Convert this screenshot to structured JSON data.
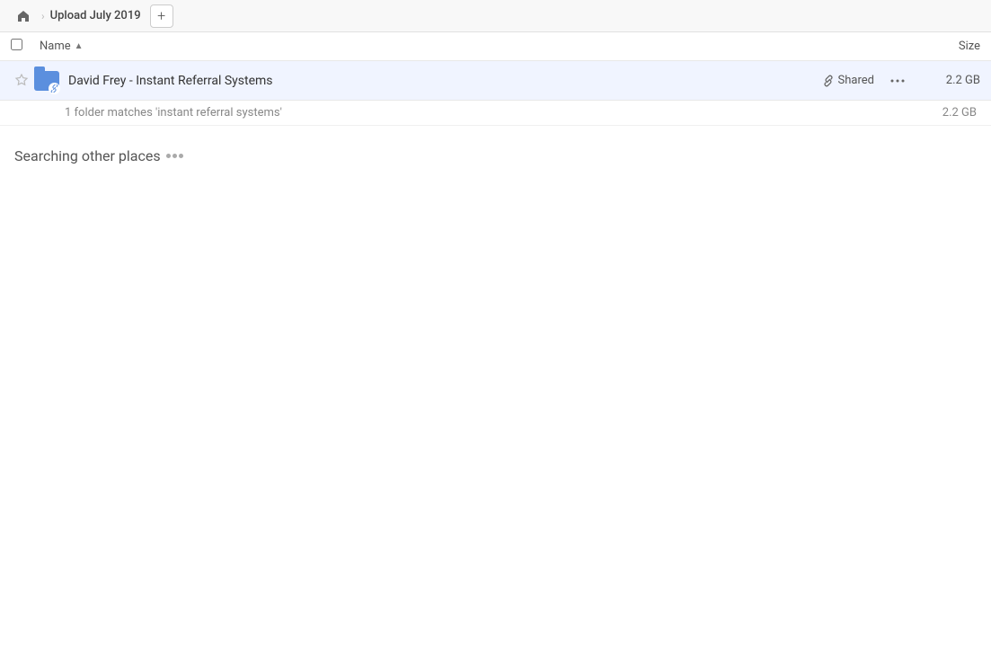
{
  "topbar": {
    "home_title": "Home",
    "breadcrumb_label": "Upload July 2019",
    "add_button_label": "+"
  },
  "columns": {
    "name_label": "Name",
    "size_label": "Size",
    "sort_indicator": "▲"
  },
  "file_row": {
    "name": "David Frey - Instant Referral Systems",
    "shared_label": "Shared",
    "size": "2.2 GB",
    "more_icon": "•••"
  },
  "match_info": {
    "text": "1 folder matches 'instant referral systems'",
    "size": "2.2 GB"
  },
  "searching": {
    "title": "Searching other places"
  },
  "icons": {
    "home": "⌂",
    "separator": "›",
    "link": "🔗",
    "star_empty": "☆",
    "sort_up": "▲",
    "more": "···"
  }
}
